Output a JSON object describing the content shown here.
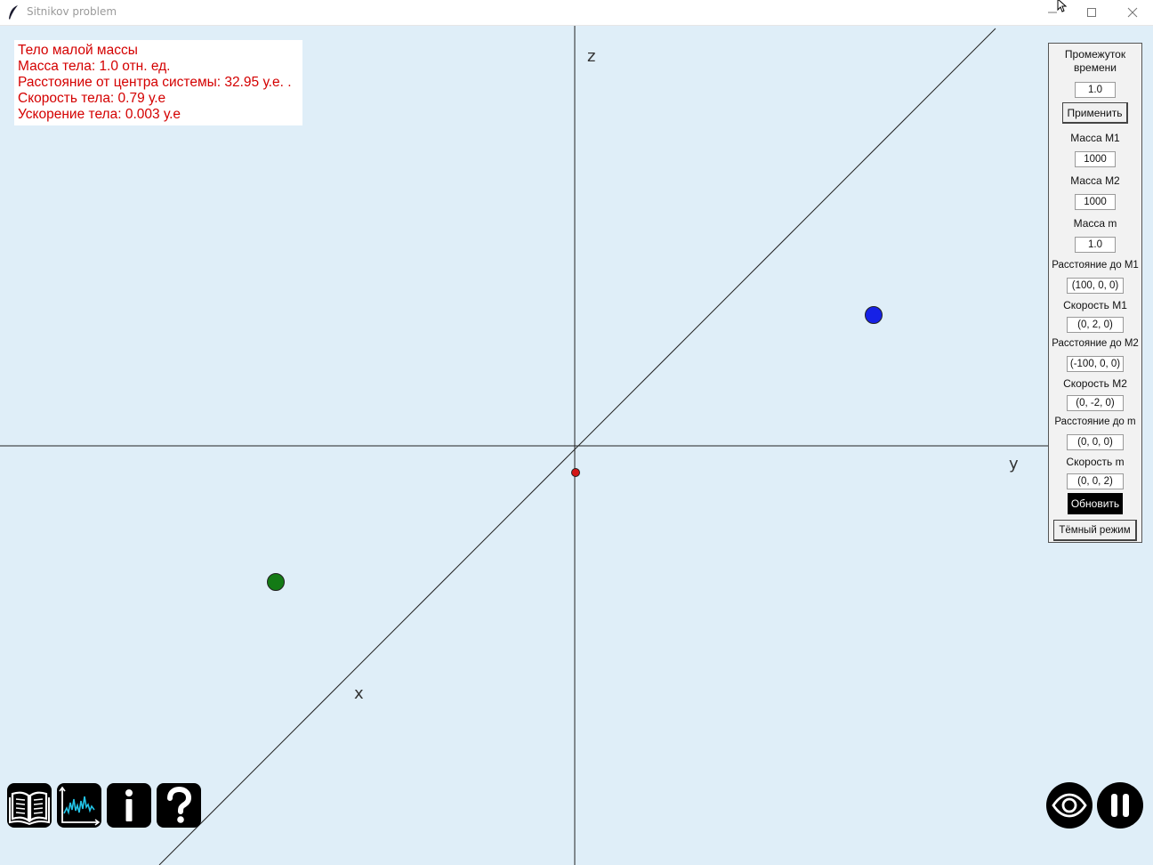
{
  "window": {
    "title": "Sitnikov problem"
  },
  "axes": {
    "x": "x",
    "y": "y",
    "z": "z"
  },
  "info": {
    "lines": [
      "Тело малой массы",
      "Масса тела: 1.0 отн. ед.",
      "Расстояние от центра системы: 32.95 у.е. .",
      "Скорость тела: 0.79 у.е",
      "Ускорение тела: 0.003 у.е"
    ]
  },
  "panel": {
    "time_label": "Промежуток времени",
    "time_value": "1.0",
    "apply_label": "Применить",
    "mass_m1_label": "Масса M1",
    "mass_m1_value": "1000",
    "mass_m2_label": "Масса M2",
    "mass_m2_value": "1000",
    "mass_m_label": "Масса m",
    "mass_m_value": "1.0",
    "dist_m1_label": "Расстояние до M1",
    "dist_m1_value": "(100, 0, 0)",
    "vel_m1_label": "Скорость M1",
    "vel_m1_value": "(0, 2, 0)",
    "dist_m2_label": "Расстояние до M2",
    "dist_m2_value": "(-100, 0, 0)",
    "vel_m2_label": "Скорость M2",
    "vel_m2_value": "(0, -2, 0)",
    "dist_m_label": "Расстояние до m",
    "dist_m_value": "(0, 0, 0)",
    "vel_m_label": "Скорость m",
    "vel_m_value": "(0, 0, 2)",
    "update_label": "Обновить",
    "dark_label": "Тёмный режим"
  },
  "colors": {
    "background": "#dfeef8",
    "body_m1": "#1621e6",
    "body_m2": "#137a15",
    "body_m": "#d41616",
    "info_text": "#d40000"
  },
  "icons": {
    "bottom_left": [
      "book-icon",
      "chart-icon",
      "info-icon",
      "help-icon"
    ],
    "bottom_right": [
      "eye-icon",
      "pause-icon"
    ]
  }
}
